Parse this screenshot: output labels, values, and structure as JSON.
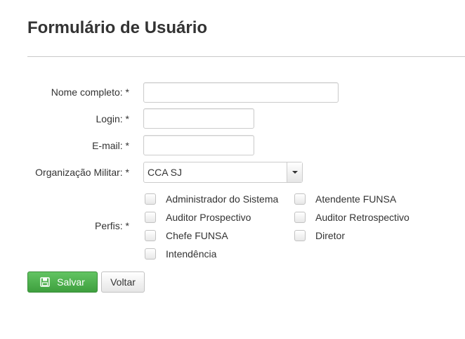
{
  "page": {
    "title": "Formulário de Usuário"
  },
  "form": {
    "nome_label": "Nome completo: *",
    "nome_value": "",
    "login_label": "Login: *",
    "login_value": "",
    "email_label": "E-mail: *",
    "email_value": "",
    "org_label": "Organização Militar: *",
    "org_value": "CCA SJ",
    "perfis_label": "Perfis: *",
    "perfis": [
      {
        "label": "Administrador do Sistema",
        "checked": false
      },
      {
        "label": "Atendente FUNSA",
        "checked": false
      },
      {
        "label": "Auditor Prospectivo",
        "checked": false
      },
      {
        "label": "Auditor Retrospectivo",
        "checked": false
      },
      {
        "label": "Chefe FUNSA",
        "checked": false
      },
      {
        "label": "Diretor",
        "checked": false
      },
      {
        "label": "Intendência",
        "checked": false
      }
    ]
  },
  "actions": {
    "save_label": "Salvar",
    "back_label": "Voltar"
  },
  "colors": {
    "save_button": "#4cae4c",
    "divider": "#c8c8c8"
  },
  "icons": {
    "save": "floppy-disk-icon",
    "dropdown": "caret-down-icon"
  }
}
